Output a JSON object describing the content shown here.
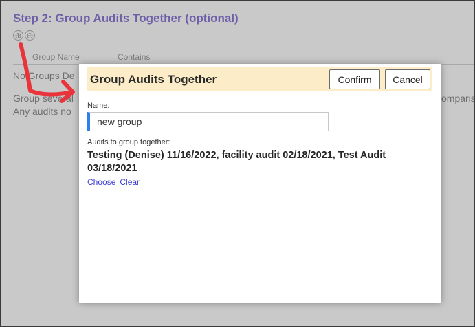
{
  "background": {
    "step_title": "Step 2: Group Audits Together (optional)",
    "add_icon_glyph": "⊕",
    "remove_icon_glyph": "⊖",
    "columns": [
      "Group Name",
      "Contains"
    ],
    "no_groups_text": "No Groups De",
    "description_line1_left": "Group several",
    "description_line1_right": "omparis",
    "description_line2_left": "Any audits no"
  },
  "modal": {
    "title": "Group Audits Together",
    "confirm_label": "Confirm",
    "cancel_label": "Cancel",
    "name_label": "Name:",
    "name_value": "new group",
    "audits_label": "Audits to group together:",
    "audits_list": "Testing (Denise) 11/16/2022, facility audit 02/18/2021, Test Audit 03/18/2021",
    "choose_link": "Choose",
    "clear_link": "Clear"
  },
  "colors": {
    "accent": "#6e5fa8",
    "header_bg": "#fcecc7",
    "input_accent": "#2f80ed",
    "link": "#3b3bd6",
    "annotation_arrow": "#e8343a"
  },
  "icons": {
    "add": "plus-circle-icon",
    "remove": "minus-circle-icon"
  }
}
